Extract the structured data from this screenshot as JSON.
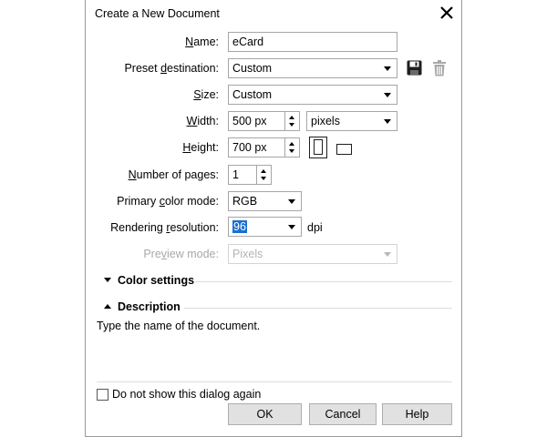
{
  "dialog": {
    "title": "Create a New Document"
  },
  "form": {
    "name_label": "Name:",
    "name_value": "eCard",
    "preset_label": "Preset destination:",
    "preset_value": "Custom",
    "size_label": "Size:",
    "size_value": "Custom",
    "width_label": "Width:",
    "width_value": "500 px",
    "units_value": "pixels",
    "height_label": "Height:",
    "height_value": "700 px",
    "pages_label": "Number of pages:",
    "pages_value": "1",
    "color_mode_label": "Primary color mode:",
    "color_mode_value": "RGB",
    "resolution_label": "Rendering resolution:",
    "resolution_value": "96",
    "resolution_unit": "dpi",
    "preview_label": "Preview mode:",
    "preview_value": "Pixels"
  },
  "sections": {
    "color_settings": "Color settings",
    "description": "Description"
  },
  "description_text": "Type the name of the document.",
  "footer": {
    "checkbox_label": "Do not show this dialog again",
    "checkbox_checked": false,
    "ok": "OK",
    "cancel": "Cancel",
    "help": "Help"
  },
  "icons": {
    "close": "close-icon",
    "save_preset": "floppy-disk-icon",
    "delete_preset": "trash-icon",
    "portrait": "portrait-orientation-icon",
    "landscape": "landscape-orientation-icon"
  },
  "colors": {
    "selection": "#1a6fd0",
    "button_face": "#e1e1e1"
  }
}
